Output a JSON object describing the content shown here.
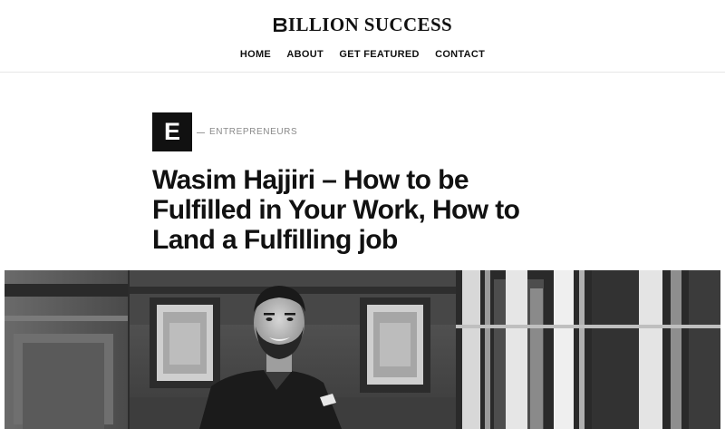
{
  "site": {
    "logo_text": "ILLION SUCCESS",
    "logo_icon": "b-monogram-icon"
  },
  "nav": {
    "items": [
      {
        "label": "HOME"
      },
      {
        "label": "ABOUT"
      },
      {
        "label": "GET FEATURED"
      },
      {
        "label": "CONTACT"
      }
    ]
  },
  "article": {
    "category_initial": "E",
    "category": "ENTREPRENEURS",
    "title": "Wasim Hajjiri – How to be Fulfilled in Your Work, How to Land a Fulfilling job",
    "hero_image_icon": "portrait-photo"
  },
  "colors": {
    "text": "#111111",
    "muted": "#8a8a8a",
    "border": "#e6e6e6",
    "category_box": "#111111"
  }
}
